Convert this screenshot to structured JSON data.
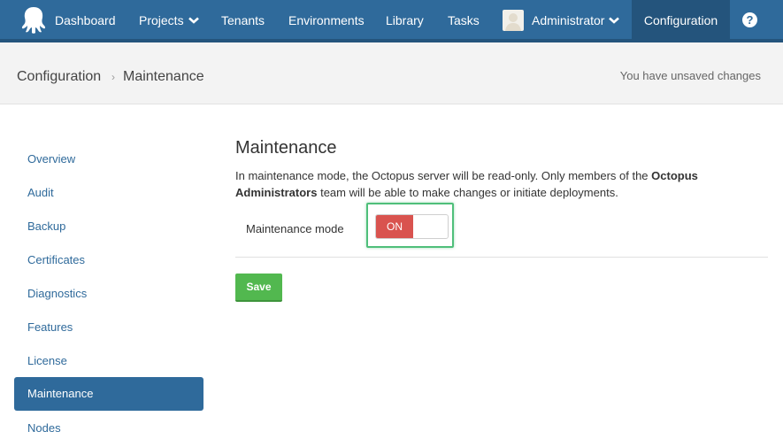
{
  "nav": {
    "items": [
      {
        "label": "Dashboard"
      },
      {
        "label": "Projects"
      },
      {
        "label": "Tenants"
      },
      {
        "label": "Environments"
      },
      {
        "label": "Library"
      },
      {
        "label": "Tasks"
      }
    ],
    "user": "Administrator",
    "configuration": "Configuration",
    "help": "?"
  },
  "breadcrumb": {
    "root": "Configuration",
    "separator": "›",
    "current": "Maintenance"
  },
  "status": {
    "unsaved": "You have unsaved changes"
  },
  "sidebar": {
    "items": [
      {
        "label": "Overview"
      },
      {
        "label": "Audit"
      },
      {
        "label": "Backup"
      },
      {
        "label": "Certificates"
      },
      {
        "label": "Diagnostics"
      },
      {
        "label": "Features"
      },
      {
        "label": "License"
      },
      {
        "label": "Maintenance"
      },
      {
        "label": "Nodes"
      }
    ],
    "active_index": 7
  },
  "main": {
    "title": "Maintenance",
    "description": {
      "part1": "In maintenance mode, the Octopus server will be read-only. Only members of the ",
      "bold": "Octopus Administrators",
      "part2": " team will be able to make changes or initiate deployments."
    },
    "field_label": "Maintenance mode",
    "toggle_state": "ON",
    "save_label": "Save"
  },
  "colors": {
    "nav_bg": "#2f6a9b",
    "nav_active": "#24547c",
    "toggle_on": "#d9534f",
    "save_button": "#52b84f",
    "focus_ring": "#4fbf7a"
  }
}
